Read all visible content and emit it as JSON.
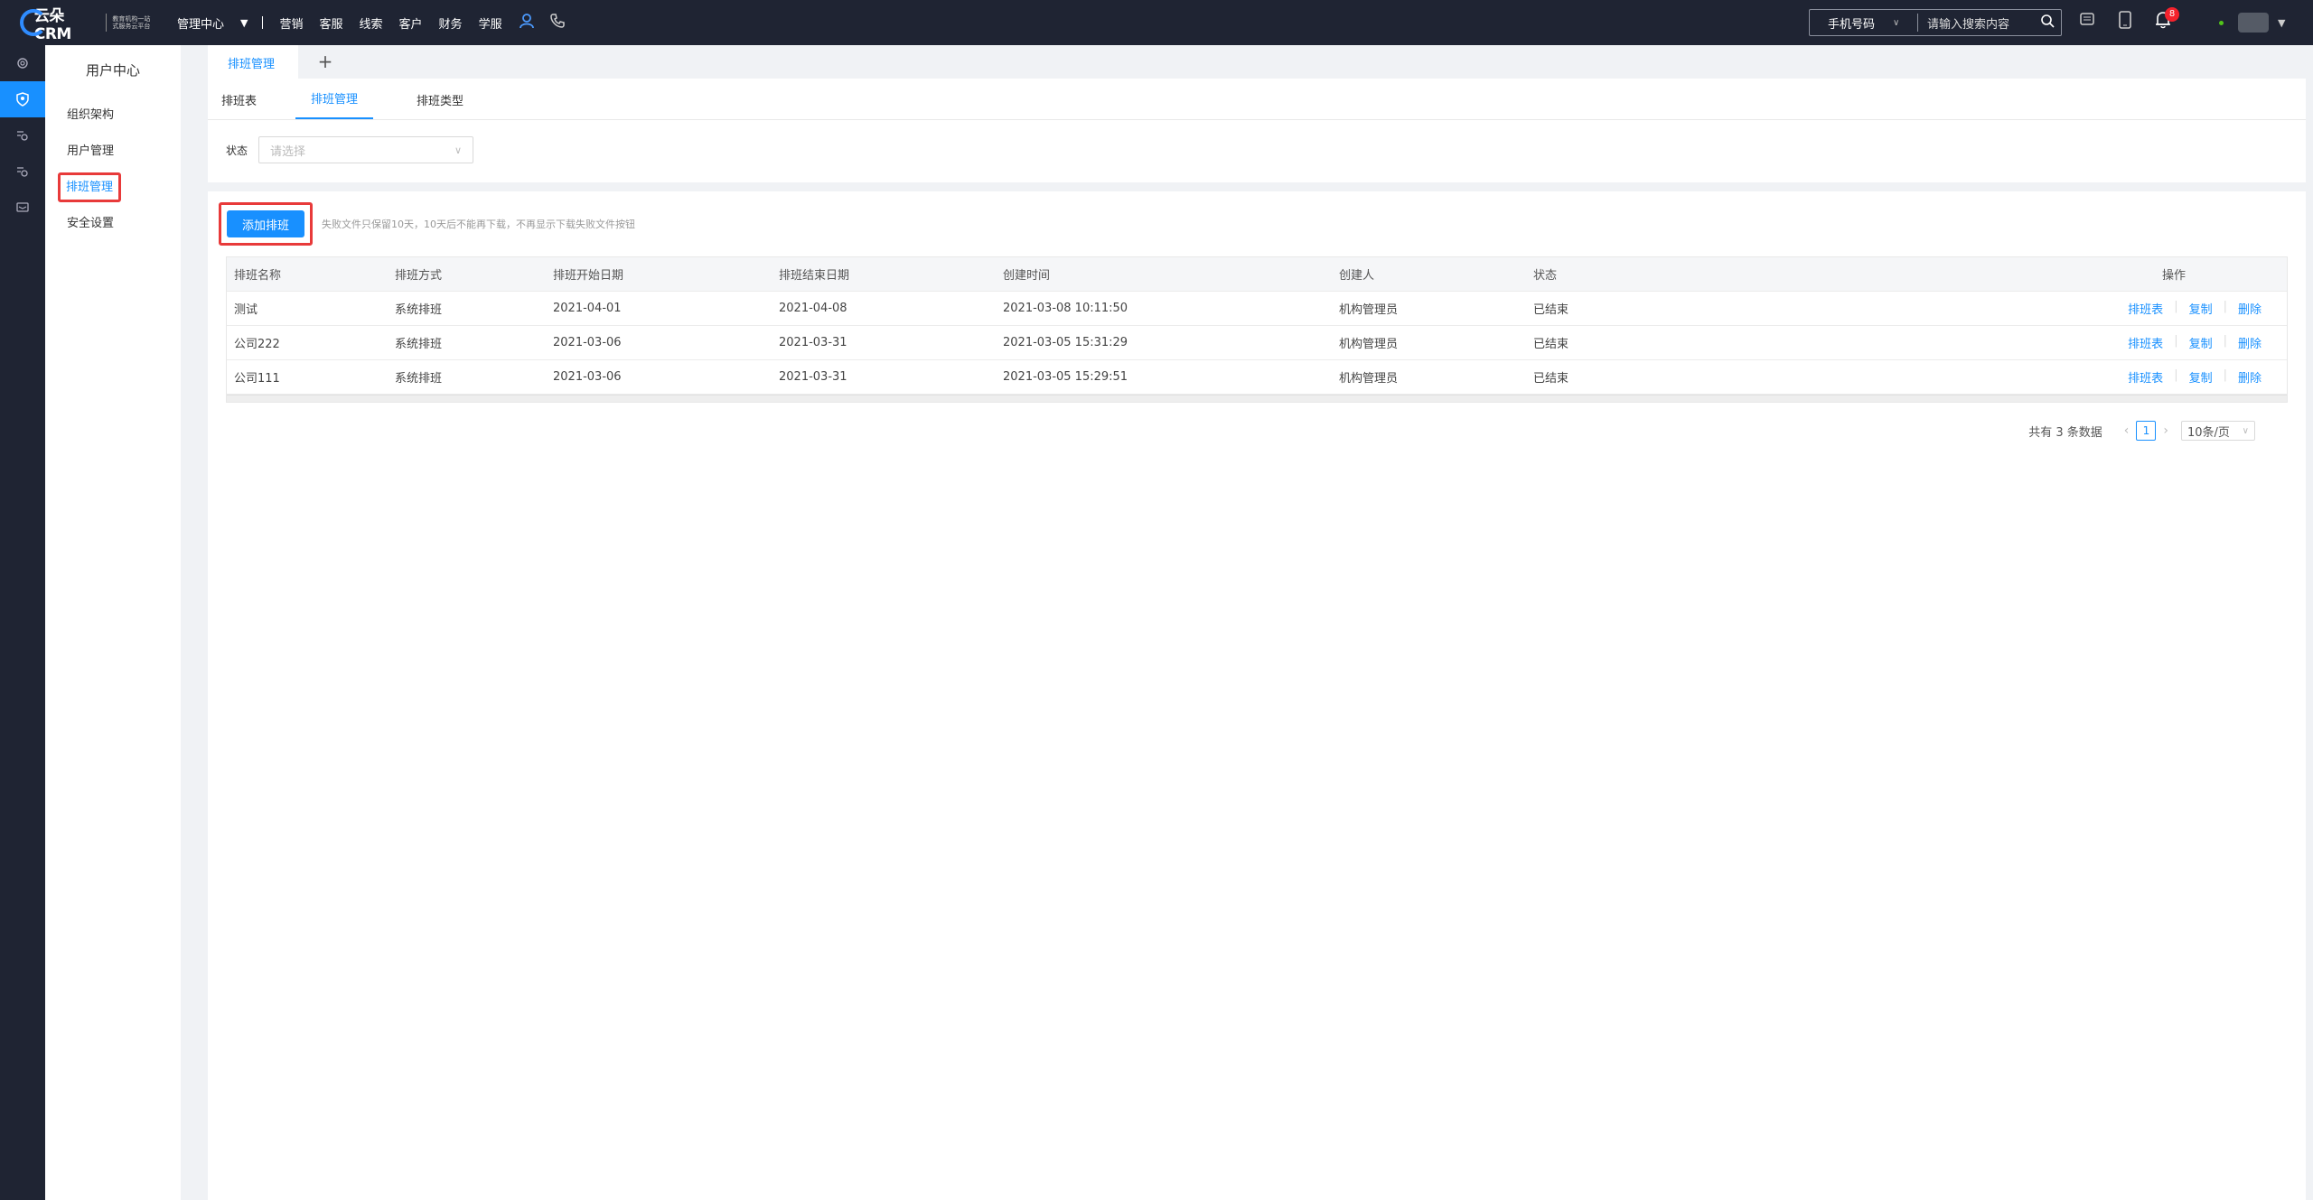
{
  "topbar": {
    "logo_text": "云朵CRM",
    "logo_slogan": "教育机构一站式服务云平台",
    "center_label": "管理中心",
    "nav": [
      "营销",
      "客服",
      "线索",
      "客户",
      "财务",
      "学服"
    ],
    "search_type": "手机号码",
    "search_placeholder": "请输入搜索内容",
    "notification_count": "8"
  },
  "sidebar": {
    "title": "用户中心",
    "items": [
      {
        "label": "组织架构"
      },
      {
        "label": "用户管理"
      },
      {
        "label": "排班管理"
      },
      {
        "label": "安全设置"
      }
    ]
  },
  "page_tab": "排班管理",
  "subtabs": [
    "排班表",
    "排班管理",
    "排班类型"
  ],
  "filter": {
    "label": "状态",
    "placeholder": "请选择"
  },
  "actions": {
    "add_label": "添加排班",
    "hint": "失败文件只保留10天，10天后不能再下载，不再显示下载失败文件按钮"
  },
  "table": {
    "headers": [
      "排班名称",
      "排班方式",
      "排班开始日期",
      "排班结束日期",
      "创建时间",
      "创建人",
      "状态",
      "操作"
    ],
    "rows": [
      {
        "name": "测试",
        "mode": "系统排班",
        "start": "2021-04-01",
        "end": "2021-04-08",
        "created": "2021-03-08 10:11:50",
        "creator": "机构管理员",
        "status": "已结束"
      },
      {
        "name": "公司222",
        "mode": "系统排班",
        "start": "2021-03-06",
        "end": "2021-03-31",
        "created": "2021-03-05 15:31:29",
        "creator": "机构管理员",
        "status": "已结束"
      },
      {
        "name": "公司111",
        "mode": "系统排班",
        "start": "2021-03-06",
        "end": "2021-03-31",
        "created": "2021-03-05 15:29:51",
        "creator": "机构管理员",
        "status": "已结束"
      }
    ],
    "ops": [
      "排班表",
      "复制",
      "删除"
    ]
  },
  "pagination": {
    "total_text": "共有 3 条数据",
    "current": "1",
    "page_size": "10条/页"
  }
}
